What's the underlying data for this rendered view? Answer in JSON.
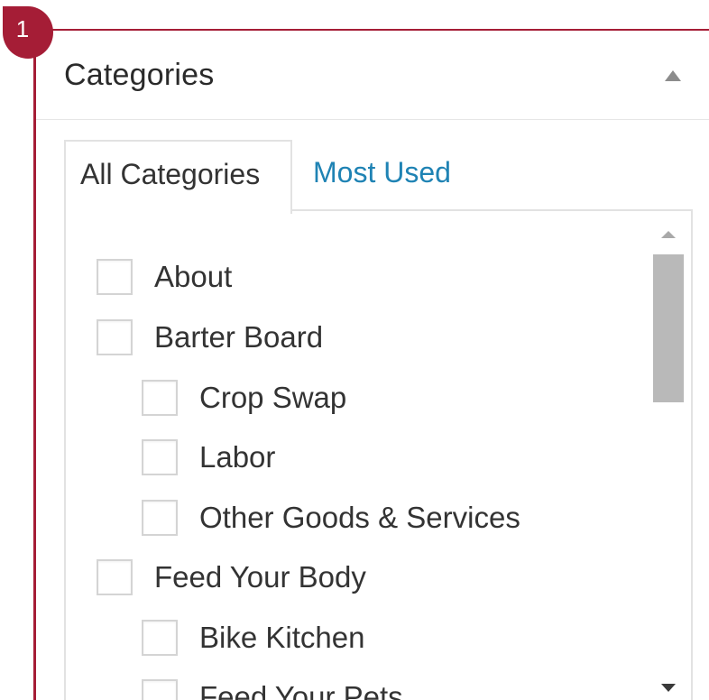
{
  "annotation": {
    "badge_number": "1"
  },
  "postbox": {
    "title": "Categories",
    "toggle_icon": "triangle-up-icon"
  },
  "tabs": [
    {
      "label": "All Categories",
      "active": true
    },
    {
      "label": "Most Used",
      "active": false
    }
  ],
  "colors": {
    "annotation": "#a51d36",
    "link": "#1f83b4",
    "text": "#333333"
  },
  "categories": [
    {
      "label": "About",
      "level": 0,
      "checked": false
    },
    {
      "label": "Barter Board",
      "level": 0,
      "checked": false
    },
    {
      "label": "Crop Swap",
      "level": 1,
      "checked": false
    },
    {
      "label": "Labor",
      "level": 1,
      "checked": false
    },
    {
      "label": "Other Goods & Services",
      "level": 1,
      "checked": false
    },
    {
      "label": "Feed Your Body",
      "level": 0,
      "checked": false
    },
    {
      "label": "Bike Kitchen",
      "level": 1,
      "checked": false
    },
    {
      "label": "Feed Your Pets",
      "level": 1,
      "checked": false
    }
  ]
}
